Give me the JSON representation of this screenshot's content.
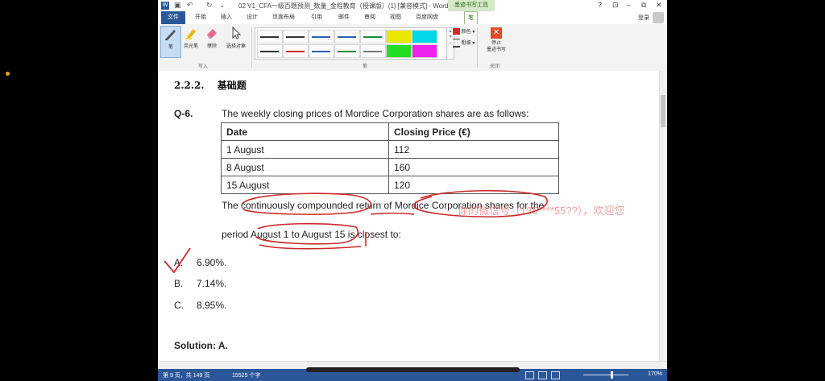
{
  "window": {
    "title": "02 V1_CFA一级百题预测_数量_金程教育（授课版）(1) [兼容模式] - Word",
    "contextual_tab": "墨迹书写工具",
    "controls": [
      "?",
      "⊡",
      "–",
      "⧉",
      "✕"
    ]
  },
  "tabs": {
    "file": "文件",
    "items": [
      "开始",
      "插入",
      "设计",
      "页面布局",
      "引用",
      "邮件",
      "审阅",
      "视图",
      "百度网盘"
    ],
    "pen": "笔",
    "login": "登录"
  },
  "ribbon": {
    "pen_btn": "笔",
    "highlighter_btn": "荧光笔",
    "eraser_btn": "擦除",
    "select_btn": "选择对象",
    "group_write": "写入",
    "group_pen": "笔",
    "color_label": "颜色",
    "thickness_label": "粗细",
    "stop_line1": "停止",
    "stop_line2": "墨迹书写",
    "group_close": "关闭"
  },
  "pen_colors": [
    "#333333",
    "#333333",
    "#2b5fb5",
    "#2b5fb5",
    "#1d8a3a",
    "#444444",
    "#e8e800",
    "#00d8e8",
    "#333333",
    "#d12a2a",
    "#2b5fb5",
    "#1d8a3a",
    "#777777",
    "#22dd22",
    "#ee22ee",
    "#333333"
  ],
  "document": {
    "section_number": "2.2.2.",
    "section_title": "基础题",
    "question_label": "Q-6.",
    "stem_line1": "The weekly closing prices of Mordice Corporation shares are as follows:",
    "table": {
      "headers": [
        "Date",
        "Closing Price (€)"
      ],
      "rows": [
        [
          "1 August",
          "112"
        ],
        [
          "8 August",
          "160"
        ],
        [
          "15 August",
          "120"
        ]
      ]
    },
    "stem_line2": "The continuously compounded return of Mordice Corporation shares for the",
    "stem_line3": "period August 1 to August 15 is closest to:",
    "options": [
      {
        "letter": "A.",
        "text": "6.90%."
      },
      {
        "letter": "B.",
        "text": "7.14%."
      },
      {
        "letter": "C.",
        "text": "8.95%."
      }
    ],
    "solution": "Solution: A.",
    "watermark": "你的微信号（135****55??），欢迎您"
  },
  "status": {
    "page": "第 9 页，共 149 页",
    "words": "15525 个字",
    "zoom": "170%"
  }
}
